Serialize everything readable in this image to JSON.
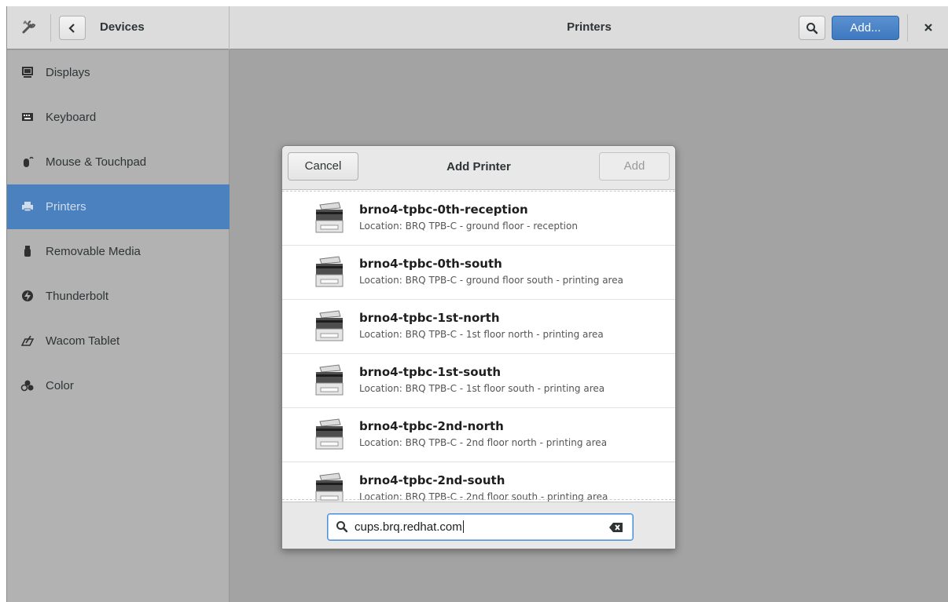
{
  "header": {
    "left_title": "Devices",
    "title": "Printers",
    "add_label": "Add...",
    "icons": {
      "tools": "tools-icon",
      "back": "chevron-left-icon",
      "search": "search-icon",
      "close": "close-icon"
    }
  },
  "sidebar": {
    "items": [
      {
        "label": "Displays",
        "icon": "display-icon"
      },
      {
        "label": "Keyboard",
        "icon": "keyboard-icon"
      },
      {
        "label": "Mouse & Touchpad",
        "icon": "mouse-icon"
      },
      {
        "label": "Printers",
        "icon": "printer-icon",
        "selected": true
      },
      {
        "label": "Removable Media",
        "icon": "usb-icon"
      },
      {
        "label": "Thunderbolt",
        "icon": "thunderbolt-icon"
      },
      {
        "label": "Wacom Tablet",
        "icon": "tablet-icon"
      },
      {
        "label": "Color",
        "icon": "color-icon"
      }
    ],
    "accent": "#4b81bf"
  },
  "dialog": {
    "title": "Add Printer",
    "cancel_label": "Cancel",
    "add_label": "Add",
    "printers": [
      {
        "name": "brno4-tpbc-0th-reception",
        "location": "Location: BRQ TPB-C - ground floor - reception"
      },
      {
        "name": "brno4-tpbc-0th-south",
        "location": "Location: BRQ TPB-C - ground floor south - printing area"
      },
      {
        "name": "brno4-tpbc-1st-north",
        "location": "Location: BRQ TPB-C - 1st floor north - printing area"
      },
      {
        "name": "brno4-tpbc-1st-south",
        "location": "Location: BRQ TPB-C - 1st floor south - printing area"
      },
      {
        "name": "brno4-tpbc-2nd-north",
        "location": "Location: BRQ TPB-C - 2nd floor north - printing area"
      },
      {
        "name": "brno4-tpbc-2nd-south",
        "location": "Location: BRQ TPB-C - 2nd floor south - printing area"
      }
    ],
    "search": {
      "value": "cups.brq.redhat.com"
    }
  }
}
